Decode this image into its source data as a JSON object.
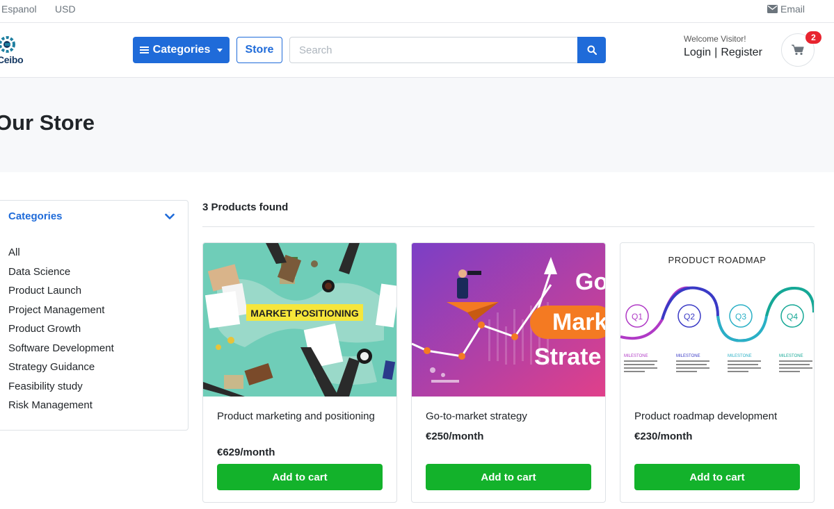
{
  "topbar": {
    "language": "Espanol",
    "currency": "USD",
    "email_label": "Email"
  },
  "header": {
    "brand": "Ceibo",
    "categories_label": "Categories",
    "store_label": "Store",
    "search_placeholder": "Search",
    "welcome": "Welcome Visitor!",
    "login_label": "Login",
    "separator": "|",
    "register_label": "Register",
    "cart_count": "2"
  },
  "hero": {
    "title": "Our Store"
  },
  "sidebar": {
    "heading": "Categories",
    "items": [
      {
        "label": "All"
      },
      {
        "label": "Data Science"
      },
      {
        "label": "Product Launch"
      },
      {
        "label": "Project Management"
      },
      {
        "label": "Product Growth"
      },
      {
        "label": "Software Development"
      },
      {
        "label": "Strategy Guidance"
      },
      {
        "label": "Feasibility study"
      },
      {
        "label": "Risk Management"
      }
    ]
  },
  "products": {
    "found_text": "3 Products found",
    "items": [
      {
        "title": "Product marketing and positioning",
        "price": "€629/month",
        "add_label": "Add to cart",
        "image_text": "MARKET POSITIONING"
      },
      {
        "title": "Go-to-market strategy",
        "price": "€250/month",
        "add_label": "Add to cart",
        "image_text": [
          "Go",
          "Mark",
          "Strate"
        ]
      },
      {
        "title": "Product roadmap development",
        "price": "€230/month",
        "add_label": "Add to cart",
        "image_text": {
          "heading": "PRODUCT ROADMAP",
          "quarters": [
            "Q1",
            "Q2",
            "Q3",
            "Q4"
          ],
          "milestone": "MILESTONE"
        }
      }
    ]
  },
  "colors": {
    "primary": "#1f6bd9",
    "success": "#13b22b",
    "badge": "#e8242f",
    "hero_bg": "#f7f8fa"
  },
  "icons": [
    "envelope-icon",
    "bars-icon",
    "caret-down-icon",
    "search-icon",
    "cart-icon",
    "chevron-down-icon",
    "logo-gear-icon"
  ]
}
